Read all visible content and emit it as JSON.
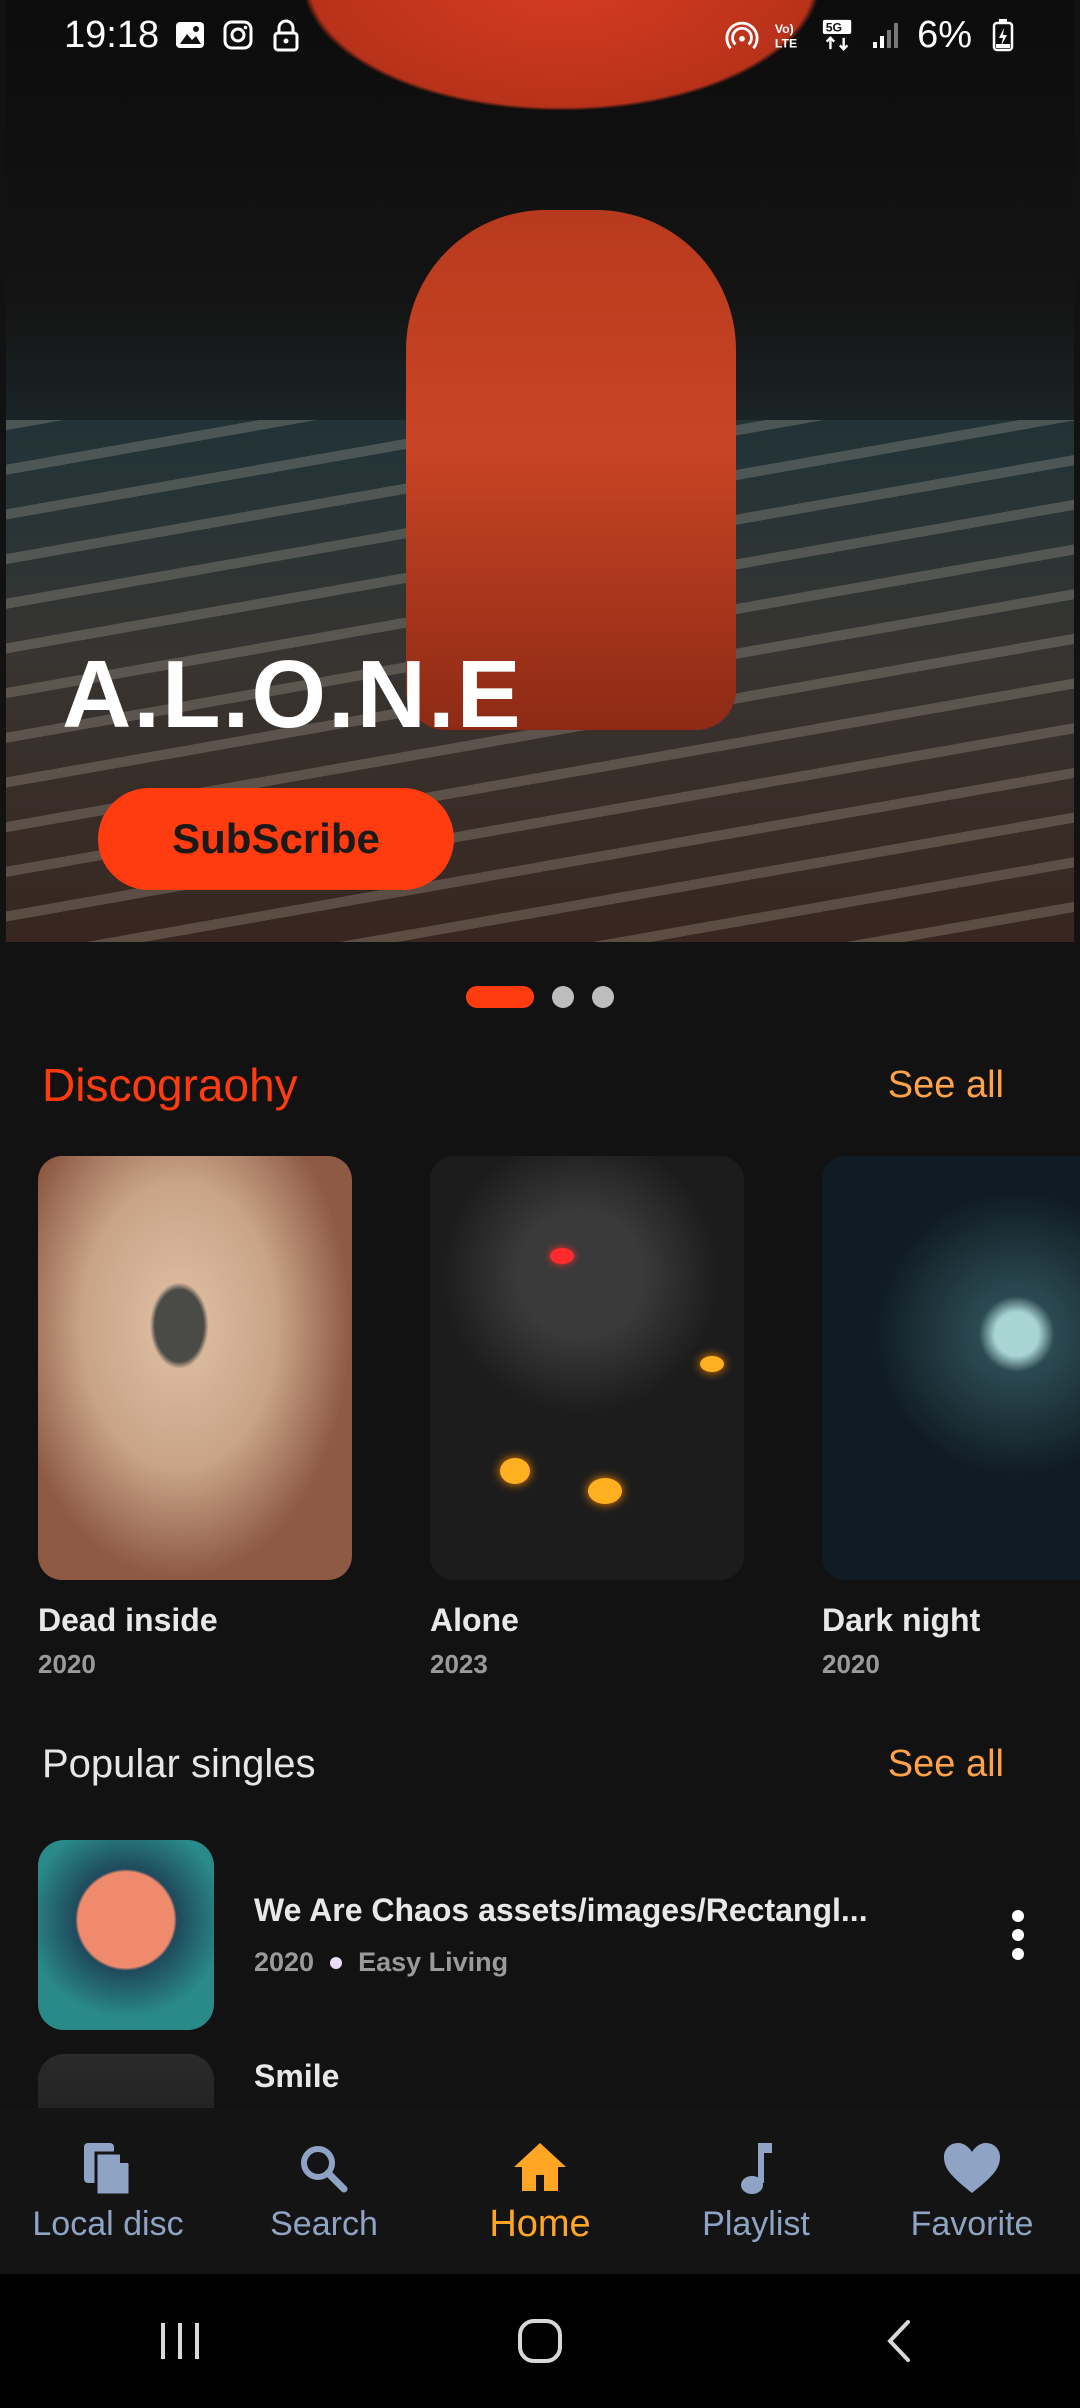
{
  "status_bar": {
    "time": "19:18",
    "battery": "6%",
    "network": "5G"
  },
  "hero": {
    "title": "A.L.O.N.E",
    "subscribe_label": "SubScribe",
    "pages": 3,
    "active_page": 1
  },
  "discography": {
    "title": "Discograohy",
    "see_all": "See all",
    "albums": [
      {
        "title": "Dead inside",
        "year": "2020"
      },
      {
        "title": "Alone",
        "year": "2023"
      },
      {
        "title": "Dark night",
        "year": "2020"
      }
    ]
  },
  "popular_singles": {
    "title": "Popular singles",
    "see_all": "See all",
    "items": [
      {
        "title": "We Are Chaos assets/images/Rectangl...",
        "year": "2020",
        "artist": "Easy Living"
      },
      {
        "title": "Smile",
        "year": "",
        "artist": ""
      }
    ]
  },
  "bottom_nav": {
    "items": [
      {
        "label": "Local disc",
        "icon": "files-icon"
      },
      {
        "label": "Search",
        "icon": "search-icon"
      },
      {
        "label": "Home",
        "icon": "home-icon"
      },
      {
        "label": "Playlist",
        "icon": "music-note-icon"
      },
      {
        "label": "Favorite",
        "icon": "heart-icon"
      }
    ],
    "active": "Home"
  },
  "colors": {
    "accent": "#ff3b10",
    "see_all": "#ffa24a",
    "nav_active": "#ffa624",
    "nav_inactive": "#8fa4c4"
  }
}
